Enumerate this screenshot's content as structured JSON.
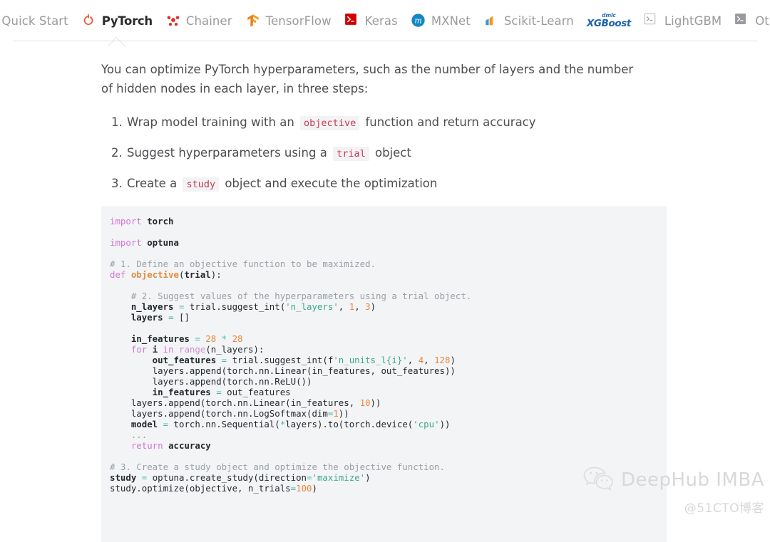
{
  "tabs": [
    {
      "label": "Quick Start",
      "icon": "optuna-rings-icon",
      "active": false
    },
    {
      "label": "PyTorch",
      "icon": "pytorch-flame-icon",
      "active": true
    },
    {
      "label": "Chainer",
      "icon": "chainer-icon",
      "active": false
    },
    {
      "label": "TensorFlow",
      "icon": "tensorflow-icon",
      "active": false
    },
    {
      "label": "Keras",
      "icon": "keras-icon",
      "active": false
    },
    {
      "label": "MXNet",
      "icon": "mxnet-icon",
      "active": false
    },
    {
      "label": "Scikit-Learn",
      "icon": "scikit-learn-icon",
      "active": false
    },
    {
      "label": "XGBoost",
      "icon": "xgboost-icon",
      "active": false
    },
    {
      "label": "LightGBM",
      "icon": "lightgbm-icon",
      "active": false
    },
    {
      "label": "Other",
      "icon": "other-terminal-icon",
      "active": false
    }
  ],
  "xgboost_logo": {
    "top": "dmlc",
    "bottom": "XGBoost"
  },
  "main": {
    "intro": "You can optimize PyTorch hyperparameters, such as the number of layers and the number of hidden nodes in each layer, in three steps:",
    "steps": [
      {
        "pre": "Wrap model training with an ",
        "code": "objective",
        "post": " function and return accuracy"
      },
      {
        "pre": "Suggest hyperparameters using a ",
        "code": "trial",
        "post": " object"
      },
      {
        "pre": "Create a ",
        "code": "study",
        "post": " object and execute the optimization"
      }
    ]
  },
  "code": {
    "language": "python",
    "lines": [
      [
        [
          "k",
          "import "
        ],
        [
          "nm",
          "torch"
        ]
      ],
      [],
      [
        [
          "k",
          "import "
        ],
        [
          "nm",
          "optuna"
        ]
      ],
      [],
      [
        [
          "cm",
          "# 1. Define an objective function to be maximized."
        ]
      ],
      [
        [
          "k",
          "def "
        ],
        [
          "fn",
          "objective"
        ],
        [
          "pl",
          "("
        ],
        [
          "nm",
          "trial"
        ],
        [
          "pl",
          "):"
        ]
      ],
      [],
      [
        [
          "pl",
          "    "
        ],
        [
          "cm",
          "# 2. Suggest values of the hyperparameters using a trial object."
        ]
      ],
      [
        [
          "nm",
          "    n_layers "
        ],
        [
          "op",
          "= "
        ],
        [
          "pl",
          "trial.suggest_int("
        ],
        [
          "st",
          "'n_layers'"
        ],
        [
          "pl",
          ", "
        ],
        [
          "nu",
          "1"
        ],
        [
          "pl",
          ", "
        ],
        [
          "nu",
          "3"
        ],
        [
          "pl",
          ")"
        ]
      ],
      [
        [
          "nm",
          "    layers "
        ],
        [
          "op",
          "= "
        ],
        [
          "pl",
          "[]"
        ]
      ],
      [],
      [
        [
          "nm",
          "    in_features "
        ],
        [
          "op",
          "= "
        ],
        [
          "nu",
          "28 "
        ],
        [
          "op",
          "* "
        ],
        [
          "nu",
          "28"
        ]
      ],
      [
        [
          "pl",
          "    "
        ],
        [
          "k",
          "for "
        ],
        [
          "nm",
          "i "
        ],
        [
          "k",
          "in "
        ],
        [
          "bi",
          "range"
        ],
        [
          "pl",
          "(n_layers):"
        ]
      ],
      [
        [
          "nm",
          "        out_features "
        ],
        [
          "op",
          "= "
        ],
        [
          "pl",
          "trial.suggest_int(f"
        ],
        [
          "st",
          "'n_units_l{i}'"
        ],
        [
          "pl",
          ", "
        ],
        [
          "nu",
          "4"
        ],
        [
          "pl",
          ", "
        ],
        [
          "nu",
          "128"
        ],
        [
          "pl",
          ")"
        ]
      ],
      [
        [
          "pl",
          "        layers.append(torch.nn.Linear(in_features, out_features))"
        ]
      ],
      [
        [
          "pl",
          "        layers.append(torch.nn.ReLU())"
        ]
      ],
      [
        [
          "nm",
          "        in_features "
        ],
        [
          "op",
          "= "
        ],
        [
          "pl",
          "out_features"
        ]
      ],
      [
        [
          "pl",
          "    layers.append(torch.nn.Linear(in_features, "
        ],
        [
          "nu",
          "10"
        ],
        [
          "pl",
          "))"
        ]
      ],
      [
        [
          "pl",
          "    layers.append(torch.nn.LogSoftmax(dim"
        ],
        [
          "op",
          "="
        ],
        [
          "nu",
          "1"
        ],
        [
          "pl",
          "))"
        ]
      ],
      [
        [
          "nm",
          "    model "
        ],
        [
          "op",
          "= "
        ],
        [
          "pl",
          "torch.nn.Sequential("
        ],
        [
          "op",
          "*"
        ],
        [
          "pl",
          "layers).to(torch.device("
        ],
        [
          "st",
          "'cpu'"
        ],
        [
          "pl",
          "))"
        ]
      ],
      [
        [
          "cm",
          "    ..."
        ]
      ],
      [
        [
          "pl",
          "    "
        ],
        [
          "k",
          "return "
        ],
        [
          "nm",
          "accuracy"
        ]
      ],
      [],
      [
        [
          "cm",
          "# 3. Create a study object and optimize the objective function."
        ]
      ],
      [
        [
          "nm",
          "study "
        ],
        [
          "op",
          "= "
        ],
        [
          "pl",
          "optuna.create_study(direction"
        ],
        [
          "op",
          "="
        ],
        [
          "st",
          "'maximize'"
        ],
        [
          "pl",
          ")"
        ]
      ],
      [
        [
          "pl",
          "study.optimize(objective, n_trials"
        ],
        [
          "op",
          "="
        ],
        [
          "nu",
          "100"
        ],
        [
          "pl",
          ")"
        ]
      ]
    ]
  },
  "watermark": {
    "name": "DeepHub IMBA",
    "sub": "@51CTO博客",
    "icon": "wechat-icon"
  }
}
